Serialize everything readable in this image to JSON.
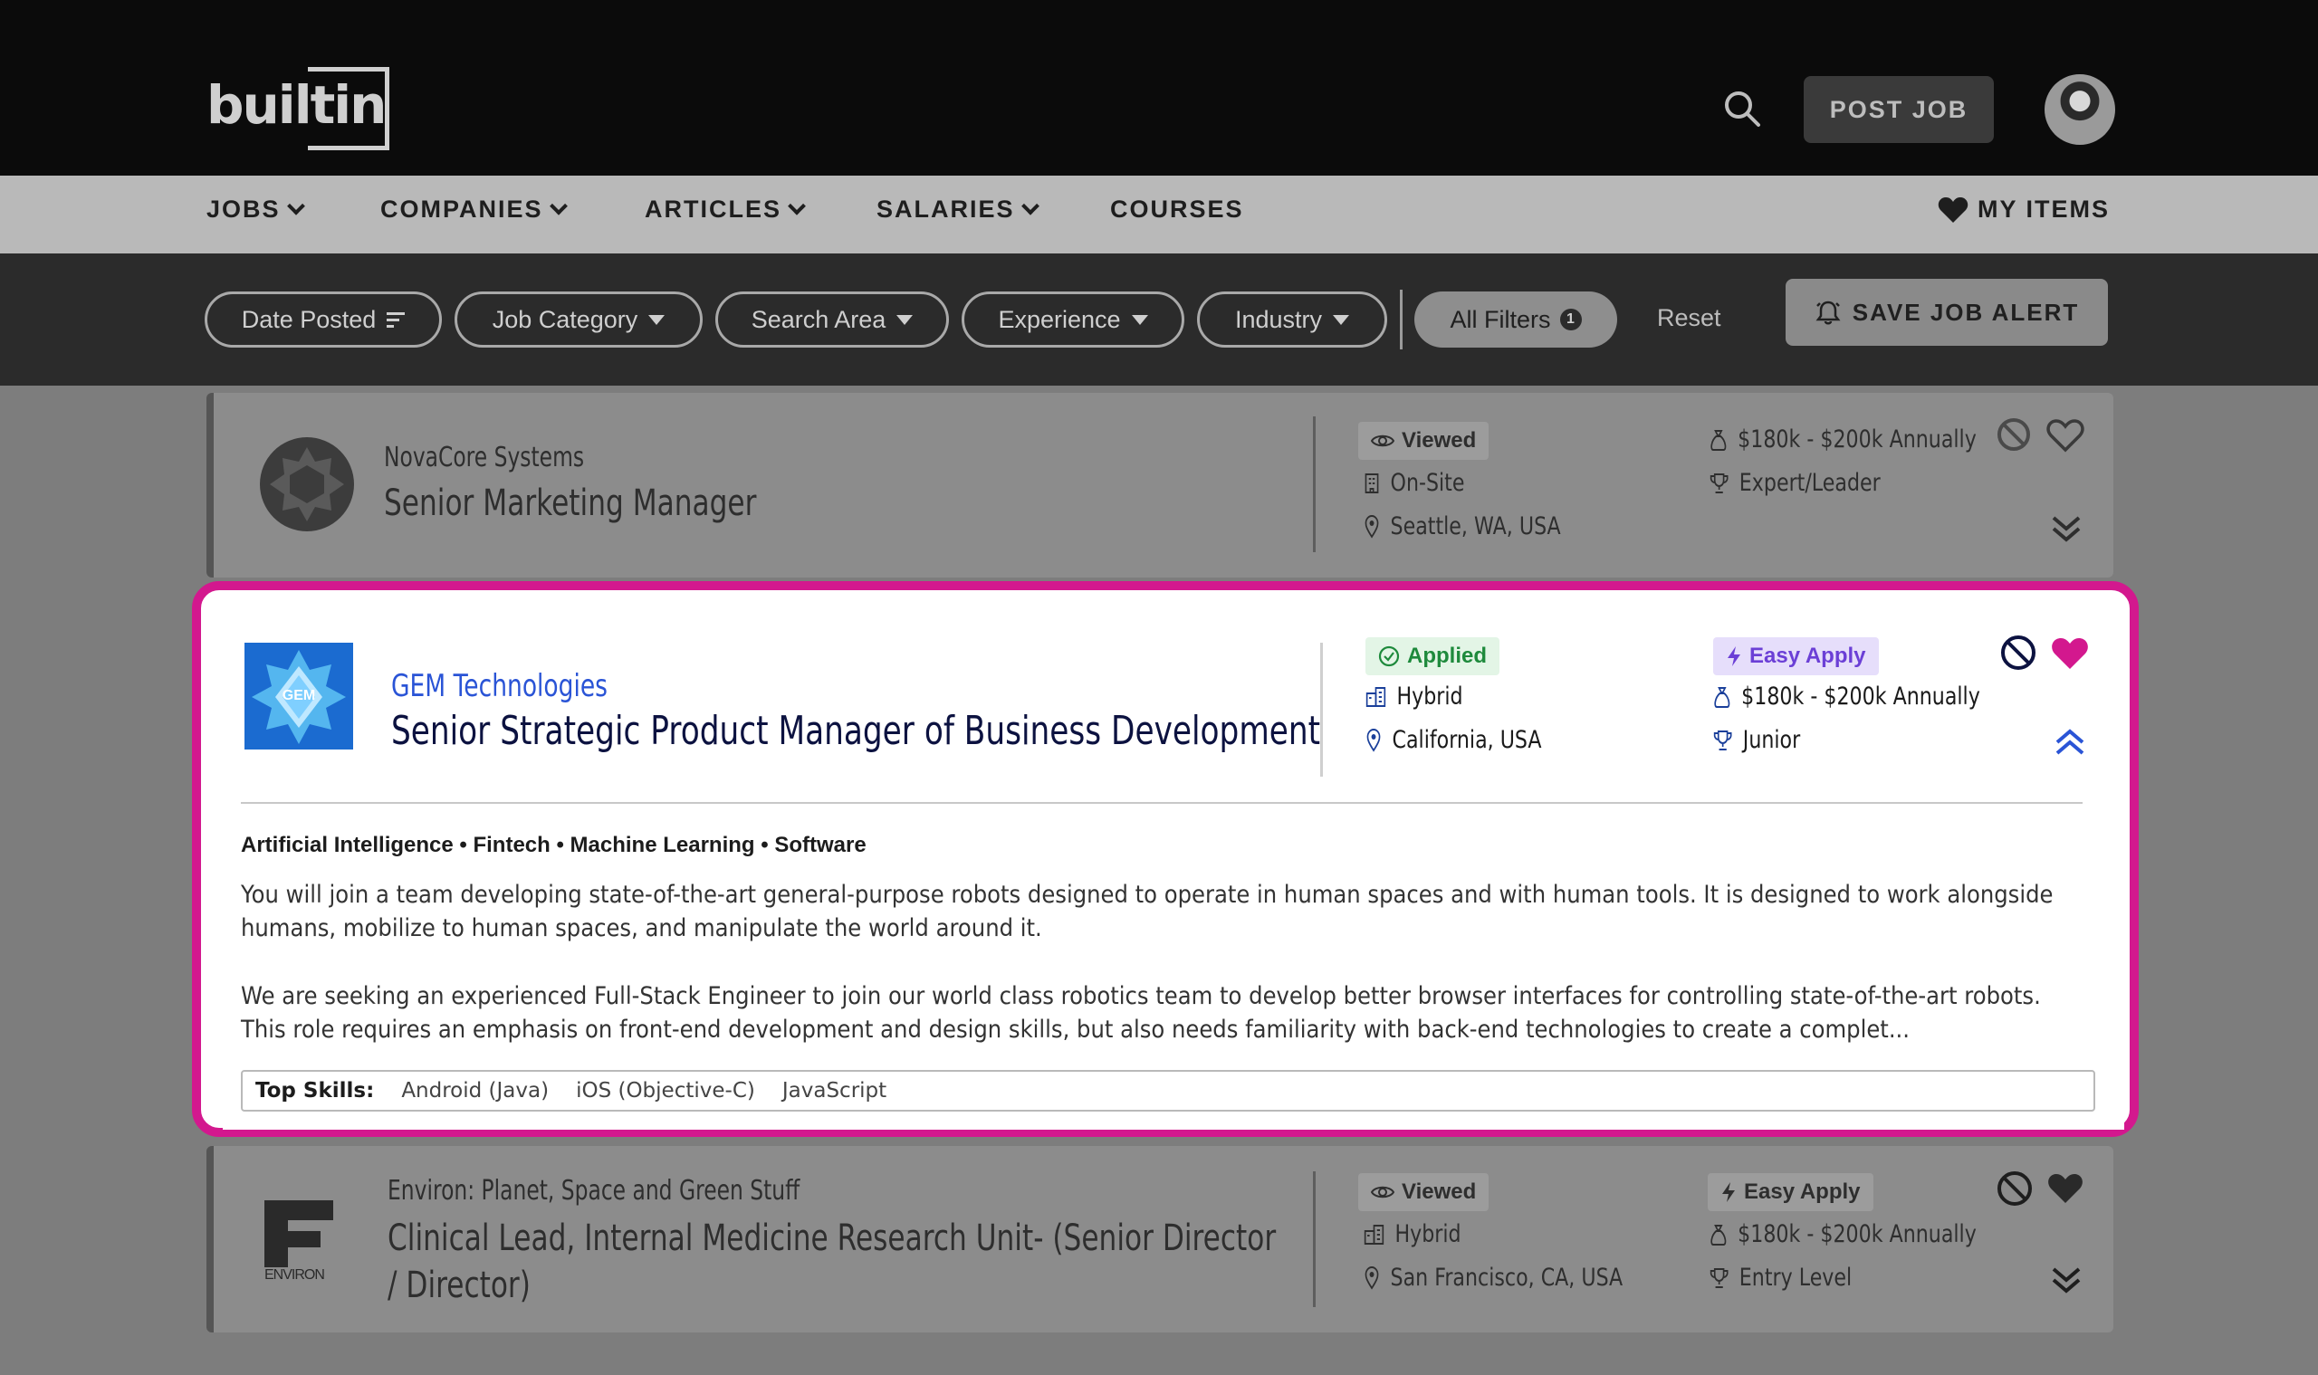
{
  "header": {
    "logo_text": "built",
    "logo_suffix": "in",
    "post_job_label": "POST JOB"
  },
  "nav": {
    "items": [
      {
        "label": "JOBS"
      },
      {
        "label": "COMPANIES"
      },
      {
        "label": "ARTICLES"
      },
      {
        "label": "SALARIES"
      },
      {
        "label": "COURSES"
      }
    ],
    "my_items_label": "MY ITEMS"
  },
  "filters": {
    "pills": [
      "Date Posted",
      "Job Category",
      "Search Area",
      "Experience",
      "Industry"
    ],
    "all_filters_label": "All Filters",
    "all_filters_count": "1",
    "reset_label": "Reset",
    "save_alert_label": "SAVE JOB ALERT"
  },
  "jobs": [
    {
      "company": "NovaCore Systems",
      "title": "Senior Marketing Manager",
      "status": "Viewed",
      "work_type": "On-Site",
      "location": "Seattle, WA, USA",
      "salary": "$180k - $200k Annually",
      "level": "Expert/Leader"
    },
    {
      "company": "GEM Technologies",
      "logo_text": "GEM",
      "title": "Senior Strategic Product Manager of Business Development",
      "status": "Applied",
      "easy_apply": "Easy Apply",
      "work_type": "Hybrid",
      "location": "California, USA",
      "salary": "$180k - $200k Annually",
      "level": "Junior",
      "industries": "Artificial Intelligence • Fintech • Machine Learning • Software",
      "description_1": "You will join a team developing state-of-the-art general-purpose robots designed to operate in human spaces and with human tools. It is designed to work alongside humans, mobilize to human spaces, and manipulate the world around it.",
      "description_2": "We are seeking an experienced Full-Stack Engineer to join our world class robotics team to develop better browser interfaces for controlling state-of-the-art robots. This role requires an emphasis on front-end development and design skills, but also needs familiarity with back-end technologies to create a complet...",
      "top_skills_label": "Top Skills:",
      "skills": [
        "Android (Java)",
        "iOS (Objective-C)",
        "JavaScript"
      ]
    },
    {
      "company": "Environ: Planet, Space and Green Stuff",
      "logo_text": "ENVIRON",
      "title_line1": "Clinical Lead, Internal Medicine Research Unit- (Senior Director",
      "title_line2": "/ Director)",
      "status": "Viewed",
      "easy_apply": "Easy Apply",
      "work_type": "Hybrid",
      "location": "San Francisco, CA, USA",
      "salary": "$180k - $200k Annually",
      "level": "Entry Level"
    }
  ],
  "colors": {
    "highlight": "#d3188e",
    "company_link": "#2a54d6",
    "applied_green": "#1e8a3c",
    "easy_apply_purple": "#6b3fd6",
    "favorite_pink": "#d3188e"
  }
}
